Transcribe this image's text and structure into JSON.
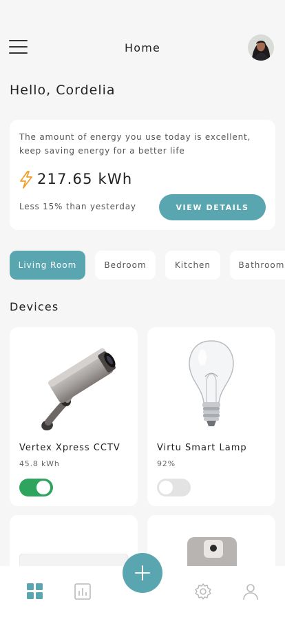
{
  "header": {
    "title": "Home",
    "menu_icon": "hamburger-menu-icon",
    "avatar_icon": "user-avatar"
  },
  "greeting": "Hello, Cordelia",
  "energy": {
    "message": "The amount of energy you use today is excellent, keep saving energy for a better life",
    "value": "217.65 kWh",
    "comparison": "Less 15% than yesterday",
    "details_button": "VIEW DETAILS",
    "icon": "lightning-bolt-icon"
  },
  "rooms": [
    {
      "label": "Living Room",
      "active": true
    },
    {
      "label": "Bedroom",
      "active": false
    },
    {
      "label": "Kitchen",
      "active": false
    },
    {
      "label": "Bathroom",
      "active": false
    }
  ],
  "devices_heading": "Devices",
  "devices": [
    {
      "name": "Vertex Xpress CCTV",
      "usage": "45.8 kWh",
      "on": true,
      "icon": "cctv-camera-icon"
    },
    {
      "name": "Virtu Smart Lamp",
      "usage": "92%",
      "on": false,
      "icon": "light-bulb-icon"
    }
  ],
  "nav": {
    "items": [
      "dashboard-grid-icon",
      "stats-chart-icon",
      "settings-gear-icon",
      "profile-user-icon"
    ],
    "fab_icon": "plus-icon"
  },
  "colors": {
    "accent": "#5aa6b0",
    "toggle_on": "#2fa45f",
    "nav_active": "#5aa6b0",
    "nav_inactive": "#b9b9b9"
  }
}
